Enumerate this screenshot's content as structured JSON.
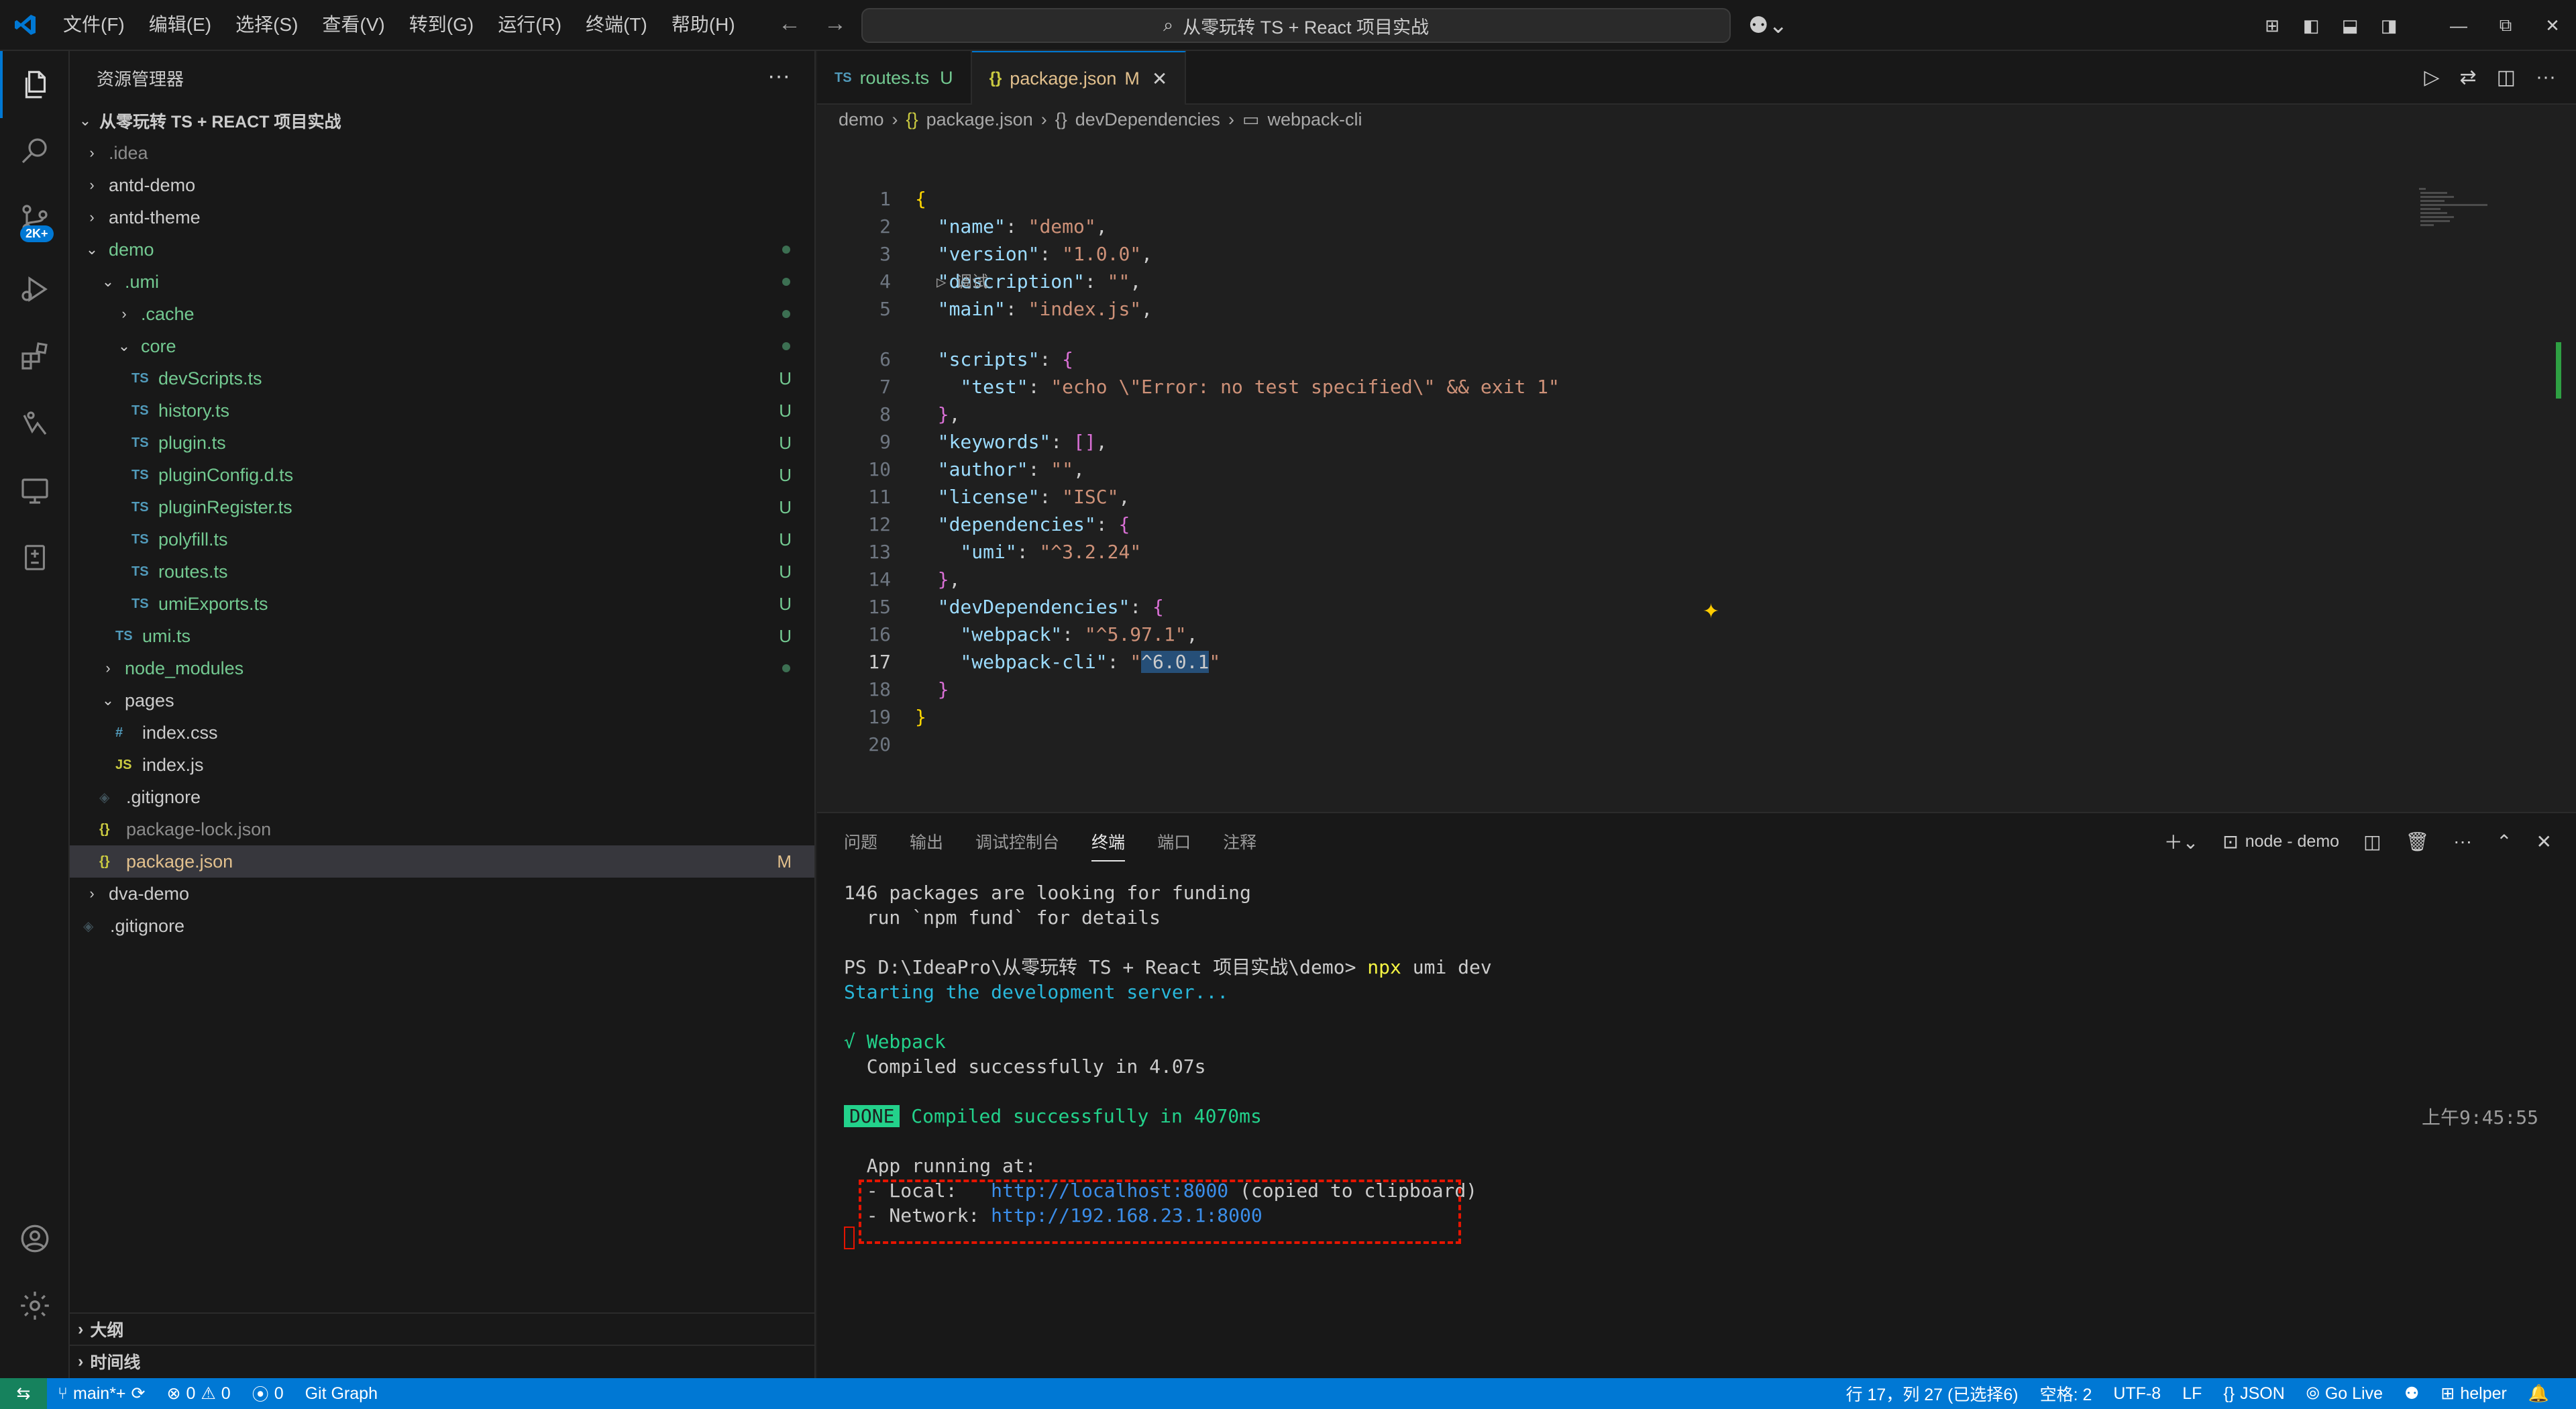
{
  "titlebar": {
    "menu": [
      "文件(F)",
      "编辑(E)",
      "选择(S)",
      "查看(V)",
      "转到(G)",
      "运行(R)",
      "终端(T)",
      "帮助(H)"
    ],
    "search_text": "从零玩转 TS + React 项目实战"
  },
  "activitybar": {
    "scm_badge": "2K+"
  },
  "sidebar": {
    "title": "资源管理器",
    "root": "从零玩转 TS + REACT 项目实战",
    "items": [
      {
        "label": ".idea",
        "type": "folder",
        "expanded": false,
        "depth": 1,
        "color": "#8c8c8c"
      },
      {
        "label": "antd-demo",
        "type": "folder",
        "expanded": false,
        "depth": 1,
        "color": "#cccccc"
      },
      {
        "label": "antd-theme",
        "type": "folder",
        "expanded": false,
        "depth": 1,
        "color": "#cccccc"
      },
      {
        "label": "demo",
        "type": "folder",
        "expanded": true,
        "depth": 1,
        "color": "#73c991",
        "dot": true
      },
      {
        "label": ".umi",
        "type": "folder",
        "expanded": true,
        "depth": 2,
        "color": "#73c991",
        "dot": true
      },
      {
        "label": ".cache",
        "type": "folder",
        "expanded": false,
        "depth": 3,
        "color": "#73c991",
        "dot": true
      },
      {
        "label": "core",
        "type": "folder",
        "expanded": true,
        "depth": 3,
        "color": "#73c991",
        "dot": true
      },
      {
        "label": "devScripts.ts",
        "type": "ts",
        "depth": 4,
        "color": "#73c991",
        "badge": "U"
      },
      {
        "label": "history.ts",
        "type": "ts",
        "depth": 4,
        "color": "#73c991",
        "badge": "U"
      },
      {
        "label": "plugin.ts",
        "type": "ts",
        "depth": 4,
        "color": "#73c991",
        "badge": "U"
      },
      {
        "label": "pluginConfig.d.ts",
        "type": "ts",
        "depth": 4,
        "color": "#73c991",
        "badge": "U"
      },
      {
        "label": "pluginRegister.ts",
        "type": "ts",
        "depth": 4,
        "color": "#73c991",
        "badge": "U"
      },
      {
        "label": "polyfill.ts",
        "type": "ts",
        "depth": 4,
        "color": "#73c991",
        "badge": "U"
      },
      {
        "label": "routes.ts",
        "type": "ts",
        "depth": 4,
        "color": "#73c991",
        "badge": "U"
      },
      {
        "label": "umiExports.ts",
        "type": "ts",
        "depth": 4,
        "color": "#73c991",
        "badge": "U"
      },
      {
        "label": "umi.ts",
        "type": "ts",
        "depth": 3,
        "color": "#73c991",
        "badge": "U"
      },
      {
        "label": "node_modules",
        "type": "folder",
        "expanded": false,
        "depth": 2,
        "color": "#73c991",
        "dot": true
      },
      {
        "label": "pages",
        "type": "folder",
        "expanded": true,
        "depth": 2,
        "color": "#cccccc"
      },
      {
        "label": "index.css",
        "type": "css",
        "depth": 3,
        "color": "#cccccc"
      },
      {
        "label": "index.js",
        "type": "js",
        "depth": 3,
        "color": "#cccccc"
      },
      {
        "label": ".gitignore",
        "type": "git",
        "depth": 2,
        "color": "#cccccc"
      },
      {
        "label": "package-lock.json",
        "type": "json",
        "depth": 2,
        "color": "#8c8c8c"
      },
      {
        "label": "package.json",
        "type": "json",
        "depth": 2,
        "color": "#e2c08d",
        "badge": "M",
        "selected": true
      },
      {
        "label": "dva-demo",
        "type": "folder",
        "expanded": false,
        "depth": 1,
        "color": "#cccccc"
      },
      {
        "label": ".gitignore",
        "type": "git",
        "depth": 1,
        "color": "#cccccc"
      }
    ],
    "sections": [
      "大纲",
      "时间线"
    ]
  },
  "editor": {
    "tabs": [
      {
        "icon": "TS",
        "label": "routes.ts",
        "badge": "U",
        "active": false
      },
      {
        "icon": "{}",
        "label": "package.json",
        "badge": "M",
        "active": true
      }
    ],
    "breadcrumb": [
      "demo",
      "package.json",
      "devDependencies",
      "webpack-cli"
    ],
    "codelens": "调试",
    "lines": [
      {
        "n": "1",
        "tokens": [
          [
            "b1",
            "{"
          ]
        ]
      },
      {
        "n": "2",
        "tokens": [
          [
            "p",
            "  "
          ],
          [
            "k",
            "\"name\""
          ],
          [
            "p",
            ": "
          ],
          [
            "s",
            "\"demo\""
          ],
          [
            "p",
            ","
          ]
        ]
      },
      {
        "n": "3",
        "tokens": [
          [
            "p",
            "  "
          ],
          [
            "k",
            "\"version\""
          ],
          [
            "p",
            ": "
          ],
          [
            "s",
            "\"1.0.0\""
          ],
          [
            "p",
            ","
          ]
        ]
      },
      {
        "n": "4",
        "tokens": [
          [
            "p",
            "  "
          ],
          [
            "k",
            "\"description\""
          ],
          [
            "p",
            ": "
          ],
          [
            "s",
            "\"\""
          ],
          [
            "p",
            ","
          ]
        ]
      },
      {
        "n": "5",
        "tokens": [
          [
            "p",
            "  "
          ],
          [
            "k",
            "\"main\""
          ],
          [
            "p",
            ": "
          ],
          [
            "s",
            "\"index.js\""
          ],
          [
            "p",
            ","
          ]
        ]
      },
      {
        "n": "6",
        "tokens": [
          [
            "p",
            "  "
          ],
          [
            "k",
            "\"scripts\""
          ],
          [
            "p",
            ": "
          ],
          [
            "b2",
            "{"
          ]
        ]
      },
      {
        "n": "7",
        "tokens": [
          [
            "p",
            "    "
          ],
          [
            "k",
            "\"test\""
          ],
          [
            "p",
            ": "
          ],
          [
            "s",
            "\"echo \\\"Error: no test specified\\\" && exit 1\""
          ]
        ]
      },
      {
        "n": "8",
        "tokens": [
          [
            "p",
            "  "
          ],
          [
            "b2",
            "}"
          ],
          [
            "p",
            ","
          ]
        ]
      },
      {
        "n": "9",
        "tokens": [
          [
            "p",
            "  "
          ],
          [
            "k",
            "\"keywords\""
          ],
          [
            "p",
            ": "
          ],
          [
            "b2",
            "[]"
          ],
          [
            "p",
            ","
          ]
        ]
      },
      {
        "n": "10",
        "tokens": [
          [
            "p",
            "  "
          ],
          [
            "k",
            "\"author\""
          ],
          [
            "p",
            ": "
          ],
          [
            "s",
            "\"\""
          ],
          [
            "p",
            ","
          ]
        ]
      },
      {
        "n": "11",
        "tokens": [
          [
            "p",
            "  "
          ],
          [
            "k",
            "\"license\""
          ],
          [
            "p",
            ": "
          ],
          [
            "s",
            "\"ISC\""
          ],
          [
            "p",
            ","
          ]
        ]
      },
      {
        "n": "12",
        "tokens": [
          [
            "p",
            "  "
          ],
          [
            "k",
            "\"dependencies\""
          ],
          [
            "p",
            ": "
          ],
          [
            "b2",
            "{"
          ]
        ]
      },
      {
        "n": "13",
        "tokens": [
          [
            "p",
            "    "
          ],
          [
            "k",
            "\"umi\""
          ],
          [
            "p",
            ": "
          ],
          [
            "s",
            "\"^3.2.24\""
          ]
        ]
      },
      {
        "n": "14",
        "tokens": [
          [
            "p",
            "  "
          ],
          [
            "b2",
            "}"
          ],
          [
            "p",
            ","
          ]
        ]
      },
      {
        "n": "15",
        "tokens": [
          [
            "p",
            "  "
          ],
          [
            "k",
            "\"devDependencies\""
          ],
          [
            "p",
            ": "
          ],
          [
            "b2",
            "{"
          ]
        ]
      },
      {
        "n": "16",
        "tokens": [
          [
            "p",
            "    "
          ],
          [
            "k",
            "\"webpack\""
          ],
          [
            "p",
            ": "
          ],
          [
            "s",
            "\"^5.97.1\""
          ],
          [
            "p",
            ","
          ]
        ]
      },
      {
        "n": "17",
        "tokens": [
          [
            "p",
            "    "
          ],
          [
            "k",
            "\"webpack-cli\""
          ],
          [
            "p",
            ": "
          ],
          [
            "s",
            "\""
          ],
          [
            "sel",
            "^6.0.1"
          ],
          [
            "s",
            "\""
          ]
        ]
      },
      {
        "n": "18",
        "tokens": [
          [
            "p",
            "  "
          ],
          [
            "b2",
            "}"
          ]
        ]
      },
      {
        "n": "19",
        "tokens": [
          [
            "b1",
            "}"
          ]
        ]
      },
      {
        "n": "20",
        "tokens": []
      }
    ]
  },
  "panel": {
    "tabs": [
      "问题",
      "输出",
      "调试控制台",
      "终端",
      "端口",
      "注释"
    ],
    "active_tab": "终端",
    "terminal_name": "node - demo",
    "timestamp": "上午9:45:55",
    "lines": [
      [
        [
          "",
          "146 packages are looking for funding"
        ]
      ],
      [
        [
          "",
          "  run `npm fund` for details"
        ]
      ],
      [],
      [
        [
          "",
          "PS D:\\IdeaPro\\从零玩转 TS + React 项目实战\\demo> "
        ],
        [
          "t-yellow",
          "npx"
        ],
        [
          "",
          " umi dev"
        ]
      ],
      [
        [
          "t-cyan",
          "Starting the development server..."
        ]
      ],
      [],
      [
        [
          "t-green",
          "√ Webpack"
        ]
      ],
      [
        [
          "",
          "  Compiled successfully in 4.07s"
        ]
      ],
      [],
      [
        [
          "t-done",
          "DONE"
        ],
        [
          "",
          " "
        ],
        [
          "t-green",
          "Compiled successfully in 4070ms"
        ]
      ],
      [],
      [
        [
          "",
          "  App running at:"
        ]
      ],
      [
        [
          "",
          "  - Local:   "
        ],
        [
          "t-link",
          "http://localhost:8000"
        ],
        [
          "",
          " (copied to clipboard)"
        ]
      ],
      [
        [
          "",
          "  - Network: "
        ],
        [
          "t-link",
          "http://192.168.23.1:8000"
        ]
      ]
    ]
  },
  "statusbar": {
    "branch": "main*+",
    "errors": "0",
    "warnings": "0",
    "ports": "0",
    "git_graph": "Git Graph",
    "cursor": "行 17，列 27 (已选择6)",
    "spaces": "空格: 2",
    "encoding": "UTF-8",
    "eol": "LF",
    "language": "JSON",
    "golive": "Go Live",
    "helper": "helper"
  }
}
